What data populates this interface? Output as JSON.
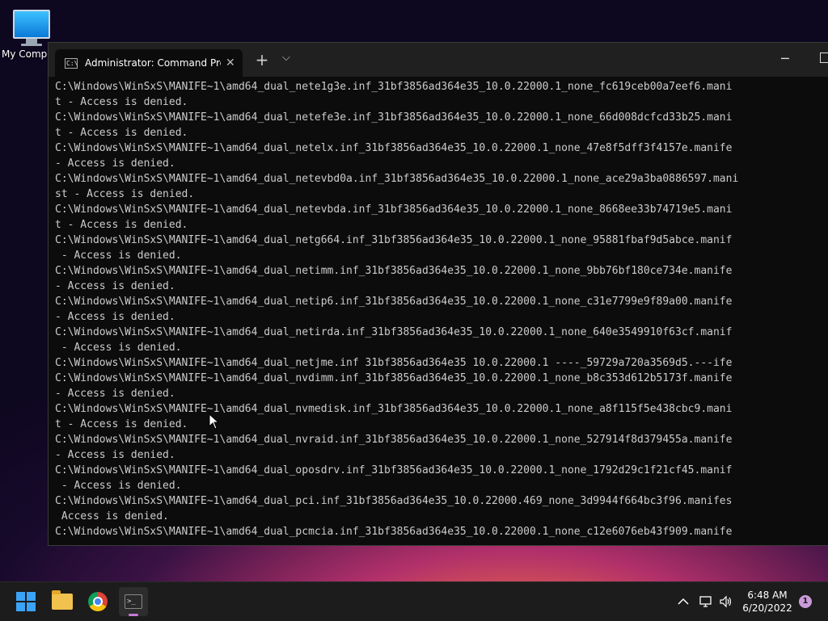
{
  "desktop": {
    "icon_label": "My Compu"
  },
  "window": {
    "tab_title": "Administrator: Command Promp",
    "tab_close": "✕",
    "new_tab": "+",
    "dropdown": "⌵",
    "minimize": "─"
  },
  "console_lines": [
    "C:\\Windows\\WinSxS\\MANIFE~1\\amd64_dual_nete1g3e.inf_31bf3856ad364e35_10.0.22000.1_none_fc619ceb00a7eef6.mani",
    "t - Access is denied.",
    "C:\\Windows\\WinSxS\\MANIFE~1\\amd64_dual_netefe3e.inf_31bf3856ad364e35_10.0.22000.1_none_66d008dcfcd33b25.mani",
    "t - Access is denied.",
    "C:\\Windows\\WinSxS\\MANIFE~1\\amd64_dual_netelx.inf_31bf3856ad364e35_10.0.22000.1_none_47e8f5dff3f4157e.manife",
    "- Access is denied.",
    "C:\\Windows\\WinSxS\\MANIFE~1\\amd64_dual_netevbd0a.inf_31bf3856ad364e35_10.0.22000.1_none_ace29a3ba0886597.mani",
    "st - Access is denied.",
    "C:\\Windows\\WinSxS\\MANIFE~1\\amd64_dual_netevbda.inf_31bf3856ad364e35_10.0.22000.1_none_8668ee33b74719e5.mani",
    "t - Access is denied.",
    "C:\\Windows\\WinSxS\\MANIFE~1\\amd64_dual_netg664.inf_31bf3856ad364e35_10.0.22000.1_none_95881fbaf9d5abce.manif",
    " - Access is denied.",
    "C:\\Windows\\WinSxS\\MANIFE~1\\amd64_dual_netimm.inf_31bf3856ad364e35_10.0.22000.1_none_9bb76bf180ce734e.manife",
    "- Access is denied.",
    "C:\\Windows\\WinSxS\\MANIFE~1\\amd64_dual_netip6.inf_31bf3856ad364e35_10.0.22000.1_none_c31e7799e9f89a00.manife",
    "- Access is denied.",
    "C:\\Windows\\WinSxS\\MANIFE~1\\amd64_dual_netirda.inf_31bf3856ad364e35_10.0.22000.1_none_640e3549910f63cf.manif",
    " - Access is denied.",
    "C:\\Windows\\WinSxS\\MANIFE~1\\amd64_dual_netjme.inf 31bf3856ad364e35 10.0.22000.1 ----_59729a720a3569d5.---ife",
    "C:\\Windows\\WinSxS\\MANIFE~1\\amd64_dual_nvdimm.inf_31bf3856ad364e35_10.0.22000.1_none_b8c353d612b5173f.manife",
    "- Access is denied.",
    "C:\\Windows\\WinSxS\\MANIFE~1\\amd64_dual_nvmedisk.inf_31bf3856ad364e35_10.0.22000.1_none_a8f115f5e438cbc9.mani",
    "t - Access is denied.",
    "C:\\Windows\\WinSxS\\MANIFE~1\\amd64_dual_nvraid.inf_31bf3856ad364e35_10.0.22000.1_none_527914f8d379455a.manife",
    "- Access is denied.",
    "C:\\Windows\\WinSxS\\MANIFE~1\\amd64_dual_oposdrv.inf_31bf3856ad364e35_10.0.22000.1_none_1792d29c1f21cf45.manif",
    " - Access is denied.",
    "C:\\Windows\\WinSxS\\MANIFE~1\\amd64_dual_pci.inf_31bf3856ad364e35_10.0.22000.469_none_3d9944f664bc3f96.manifes",
    " Access is denied.",
    "C:\\Windows\\WinSxS\\MANIFE~1\\amd64_dual_pcmcia.inf_31bf3856ad364e35_10.0.22000.1_none_c12e6076eb43f909.manife"
  ],
  "taskbar": {
    "apps": [
      "start-icon",
      "file-explorer-icon",
      "chrome-icon",
      "terminal-icon"
    ],
    "tray_chevron": "^",
    "time": "6:48 AM",
    "date": "6/20/2022",
    "notification_count": "1"
  }
}
